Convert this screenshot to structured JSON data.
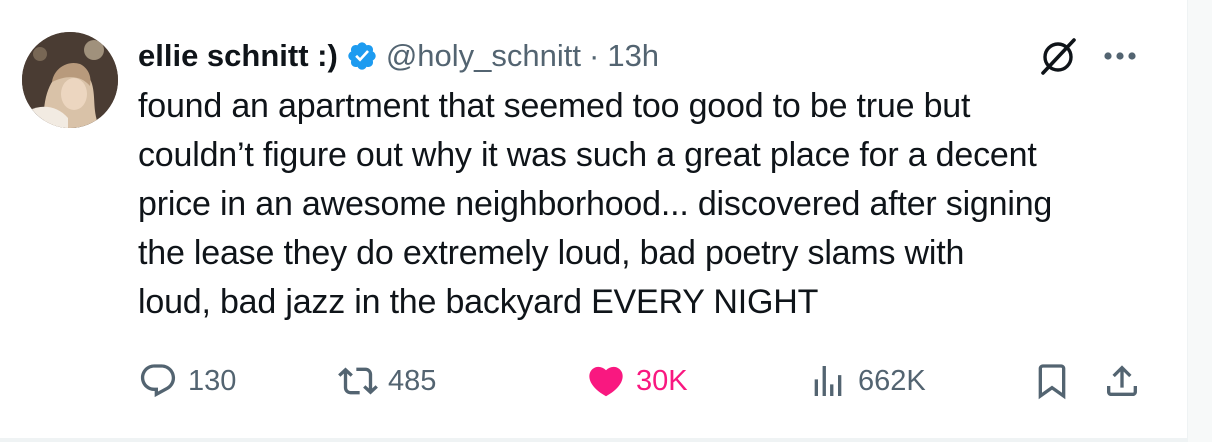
{
  "tweet": {
    "display_name": "ellie schnitt :)",
    "handle": "@holy_schnitt",
    "separator": "·",
    "time": "13h",
    "text": "found an apartment that seemed too good to be true but\ncouldn’t figure out why it was such a great place for a decent\nprice in an awesome neighborhood... discovered after signing\nthe lease they do extremely loud, bad poetry slams with\nloud, bad jazz in the backyard EVERY NIGHT"
  },
  "actions": {
    "replies": "130",
    "reposts": "485",
    "likes": "30K",
    "views": "662K"
  },
  "icons": {
    "verified": "verified-badge-icon",
    "grok": "grok-icon",
    "more": "more-icon",
    "reply": "reply-icon",
    "repost": "repost-icon",
    "like": "heart-icon",
    "views": "views-chart-icon",
    "bookmark": "bookmark-icon",
    "share": "share-icon"
  },
  "colors": {
    "verified_blue": "#1d9bf0",
    "like_pink": "#f91880",
    "secondary_text": "#536471",
    "primary_text": "#0f1419"
  }
}
